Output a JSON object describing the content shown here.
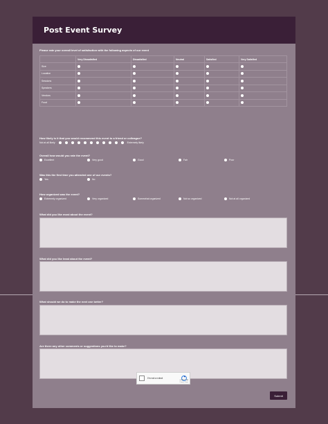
{
  "title": "Post Event Survey",
  "q1": {
    "label": "Please rate your overall level of satisfaction with the following aspects of our event",
    "columns": [
      "Very Dissatisfied",
      "Dissatisfied",
      "Neutral",
      "Satisfied",
      "Very Satisfied"
    ],
    "rows": [
      "Size",
      "Location",
      "Sessions",
      "Speakers",
      "Vendors",
      "Food"
    ]
  },
  "q2": {
    "label": "How likely is it that you would recommend this event to a friend or colleague?",
    "low": "Not at all likely",
    "high": "Extremely likely"
  },
  "q3": {
    "label": "Overall how would you rate the event?",
    "options": [
      "Excellent",
      "Very good",
      "Good",
      "Fair",
      "Poor"
    ]
  },
  "q4": {
    "label": "Was this the first time you attended one of our events?",
    "options": [
      "Yes",
      "No"
    ]
  },
  "q5": {
    "label": "How organized was the event?",
    "options": [
      "Extremely organized",
      "Very organized",
      "Somewhat organized",
      "Not so organized",
      "Not at all organized"
    ]
  },
  "q6": {
    "label": "What did you like most about the event?"
  },
  "q7": {
    "label": "What did you like least about the event?"
  },
  "q8": {
    "label": "What should we do to make the next one better?"
  },
  "q9": {
    "label": "Are there any other comments or suggestions you'd like to make?"
  },
  "captcha": {
    "label": "I'm not a robot",
    "brand": "reCAPTCHA",
    "sub": "Privacy - Terms"
  },
  "submit_label": "Submit"
}
